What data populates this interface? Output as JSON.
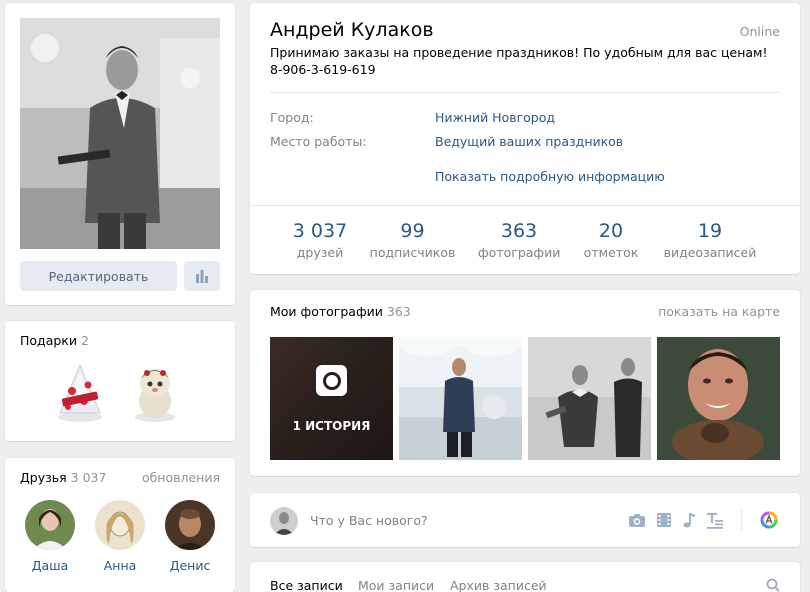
{
  "profile": {
    "name": "Андрей Кулаков",
    "online": "Online",
    "status": "Принимаю заказы на проведение праздников! По удобным для вас ценам! 8-906-3-619-619",
    "info": [
      {
        "label": "Город:",
        "value": "Нижний Новгород"
      },
      {
        "label": "Место работы:",
        "value": "Ведущий ваших праздников"
      }
    ],
    "show_more": "Показать подробную информацию",
    "counters": [
      {
        "num": "3 037",
        "label": "друзей"
      },
      {
        "num": "99",
        "label": "подписчиков"
      },
      {
        "num": "363",
        "label": "фотографии"
      },
      {
        "num": "20",
        "label": "отметок"
      },
      {
        "num": "19",
        "label": "видеозаписей"
      }
    ]
  },
  "left": {
    "edit_button": "Редактировать",
    "gifts": {
      "title": "Подарки",
      "count": "2"
    },
    "friends": {
      "title": "Друзья",
      "count": "3 037",
      "updates": "обновления",
      "list": [
        {
          "name": "Даша"
        },
        {
          "name": "Анна"
        },
        {
          "name": "Денис"
        }
      ]
    }
  },
  "photos": {
    "title": "Мои фотографии",
    "count": "363",
    "map_link": "показать на карте",
    "story_label": "1 ИСТОРИЯ"
  },
  "post": {
    "placeholder": "Что у Вас нового?"
  },
  "wall": {
    "tabs": [
      "Все записи",
      "Мои записи",
      "Архив записей"
    ]
  },
  "colors": {
    "link": "#2a5885",
    "muted": "#828282",
    "button_bg": "#e5ebf1",
    "page_bg": "#edeef0"
  },
  "icons": [
    "bar-chart-icon",
    "camera-icon",
    "video-icon",
    "music-icon",
    "text-format-icon",
    "colorful-a-icon",
    "search-icon"
  ]
}
